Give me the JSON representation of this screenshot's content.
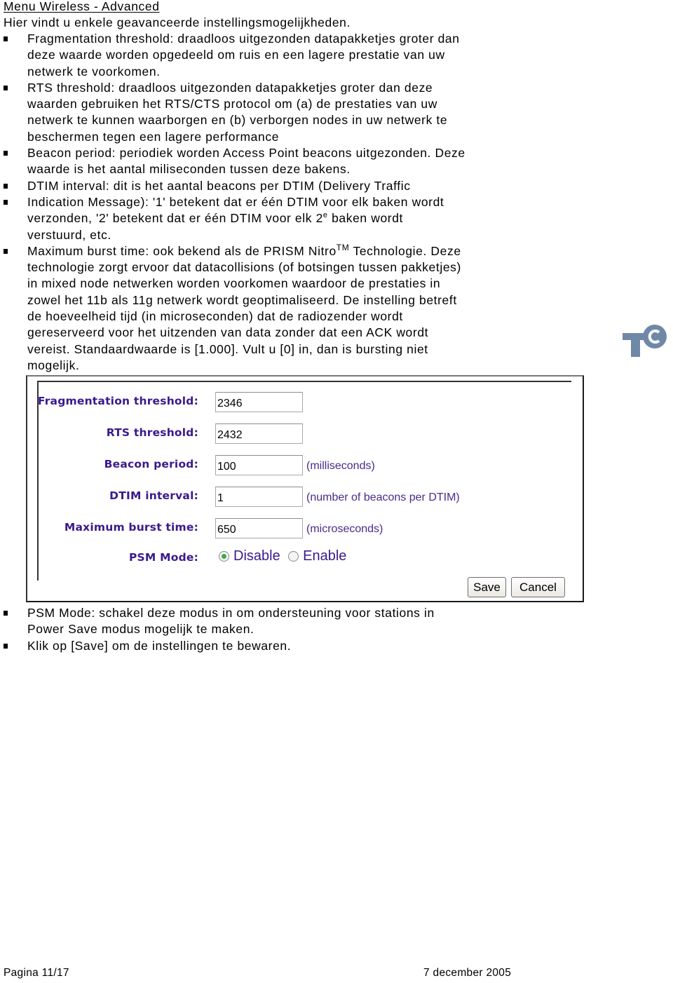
{
  "document": {
    "title": "Menu Wireless - Advanced",
    "intro": "Hier vindt u enkele geavanceerde instellingsmogelijkheden.",
    "bullets_top": [
      {
        "lines": [
          "Fragmentation threshold: draadloos uitgezonden datapakketjes groter dan",
          "deze waarde worden opgedeeld om ruis en een lagere prestatie van uw",
          "netwerk te voorkomen."
        ]
      },
      {
        "lines": [
          "RTS threshold: draadloos uitgezonden datapakketjes groter dan deze",
          "waarden gebruiken het RTS/CTS protocol om (a) de prestaties van uw",
          "netwerk te kunnen waarborgen en (b) verborgen nodes in uw netwerk te",
          "beschermen tegen een lagere performance"
        ]
      },
      {
        "lines": [
          "Beacon period: periodiek worden Access Point beacons uitgezonden. Deze",
          "waarde is het aantal miliseconden tussen deze bakens."
        ]
      },
      {
        "lines": [
          "DTIM interval: dit is het aantal beacons per DTIM (Delivery Traffic"
        ]
      },
      {
        "lines": [
          "Indication Message): '1' betekent dat er één DTIM voor elk baken wordt"
        ],
        "line2_pre": "verzonden, '2' betekent dat er één DTIM voor elk 2",
        "line2_sup": "e",
        "line2_post": " baken wordt",
        "line3": "verstuurd, etc."
      },
      {
        "line1_pre": "Maximum burst time: ook bekend als de PRISM Nitro",
        "line1_tm": "TM",
        "line1_post": " Technologie. Deze",
        "lines": [
          "technologie zorgt ervoor dat datacollisions (of botsingen tussen pakketjes)",
          "in mixed node netwerken worden voorkomen waardoor de prestaties in",
          "zowel het 11b als 11g netwerk wordt geoptimaliseerd. De instelling betreft",
          "de hoeveelheid tijd (in microseconden) dat de radiozender wordt",
          "gereserveerd voor het uitzenden van data zonder dat een ACK wordt",
          "vereist. Standaardwaarde is [1.000]. Vult u [0] in, dan is bursting niet",
          "mogelijk."
        ]
      }
    ],
    "bullets_bottom": [
      {
        "lines": [
          "PSM Mode: schakel deze modus in om ondersteuning voor stations in",
          "Power Save modus mogelijk te maken."
        ]
      },
      {
        "lines": [
          "Klik op [Save] om de instellingen te bewaren."
        ]
      }
    ]
  },
  "form": {
    "fields": [
      {
        "label": "Fragmentation threshold:",
        "value": "2346",
        "hint": ""
      },
      {
        "label": "RTS threshold:",
        "value": "2432",
        "hint": ""
      },
      {
        "label": "Beacon period:",
        "value": "100",
        "hint": "(milliseconds)"
      },
      {
        "label": "DTIM interval:",
        "value": "1",
        "hint": "(number of beacons per DTIM)"
      },
      {
        "label": "Maximum burst time:",
        "value": "650",
        "hint": "(microseconds)"
      }
    ],
    "psm": {
      "label": "PSM Mode:",
      "options": [
        {
          "label": "Disable",
          "checked": true
        },
        {
          "label": "Enable",
          "checked": false
        }
      ]
    },
    "buttons": {
      "save": "Save",
      "cancel": "Cancel"
    }
  },
  "logo": {
    "name": "TC",
    "color": "#7088a8"
  },
  "colors": {
    "label": "#3a1a8c",
    "hint": "#4a2a8c",
    "radio_checked": "#43a847"
  },
  "footer": {
    "page": "Pagina 11/17",
    "date": "7 december 2005"
  }
}
